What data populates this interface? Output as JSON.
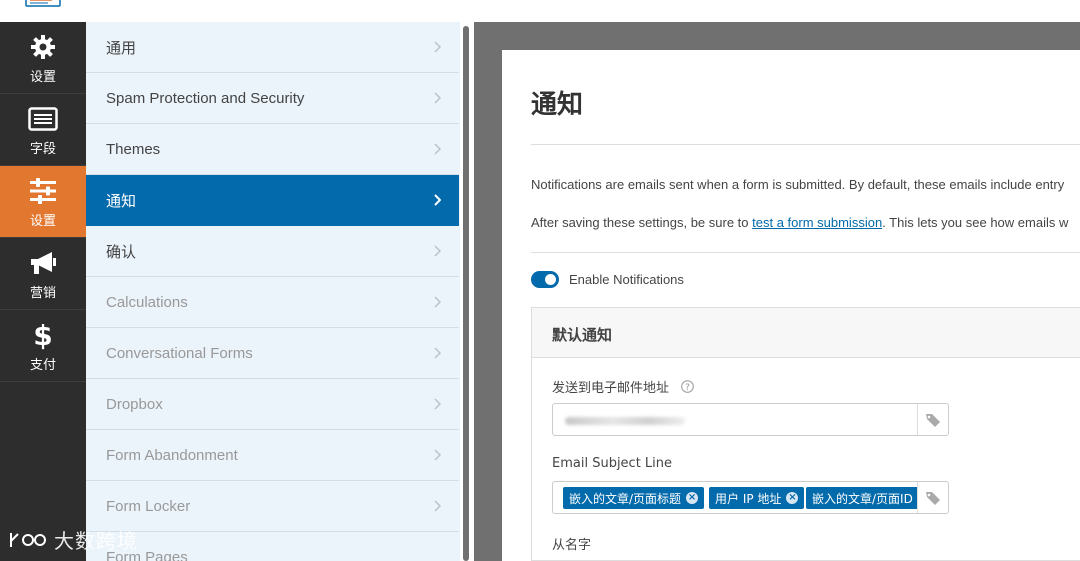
{
  "rail": {
    "items": [
      {
        "label": "设置",
        "icon": "gear-icon"
      },
      {
        "label": "字段",
        "icon": "fields-icon"
      },
      {
        "label": "设置",
        "icon": "sliders-icon"
      },
      {
        "label": "营销",
        "icon": "megaphone-icon"
      },
      {
        "label": "支付",
        "icon": "dollar-icon"
      }
    ]
  },
  "nav": {
    "items": [
      {
        "label": "通用"
      },
      {
        "label": "Spam Protection and Security"
      },
      {
        "label": "Themes"
      },
      {
        "label": "通知"
      },
      {
        "label": "确认"
      },
      {
        "label": "Calculations"
      },
      {
        "label": "Conversational Forms"
      },
      {
        "label": "Dropbox"
      },
      {
        "label": "Form Abandonment"
      },
      {
        "label": "Form Locker"
      },
      {
        "label": "Form Pages"
      }
    ]
  },
  "main": {
    "title": "通知",
    "desc1": "Notifications are emails sent when a form is submitted. By default, these emails include entry",
    "desc2_before": "After saving these settings, be sure to ",
    "desc2_link": "test a form submission",
    "desc2_after": ". This lets you see how emails w",
    "toggle_label": "Enable Notifications",
    "card_title": "默认通知",
    "field_send_to": "发送到电子邮件地址",
    "field_subject": "Email Subject Line",
    "field_from_name": "从名字",
    "subject_chips": [
      "嵌入的文章/页面标题",
      "用户 IP 地址",
      "嵌入的文章/页面ID"
    ]
  },
  "watermark": "大数跨境",
  "colors": {
    "accent": "#036aab",
    "active_rail": "#e27730",
    "rail_bg": "#2d2d2d"
  }
}
